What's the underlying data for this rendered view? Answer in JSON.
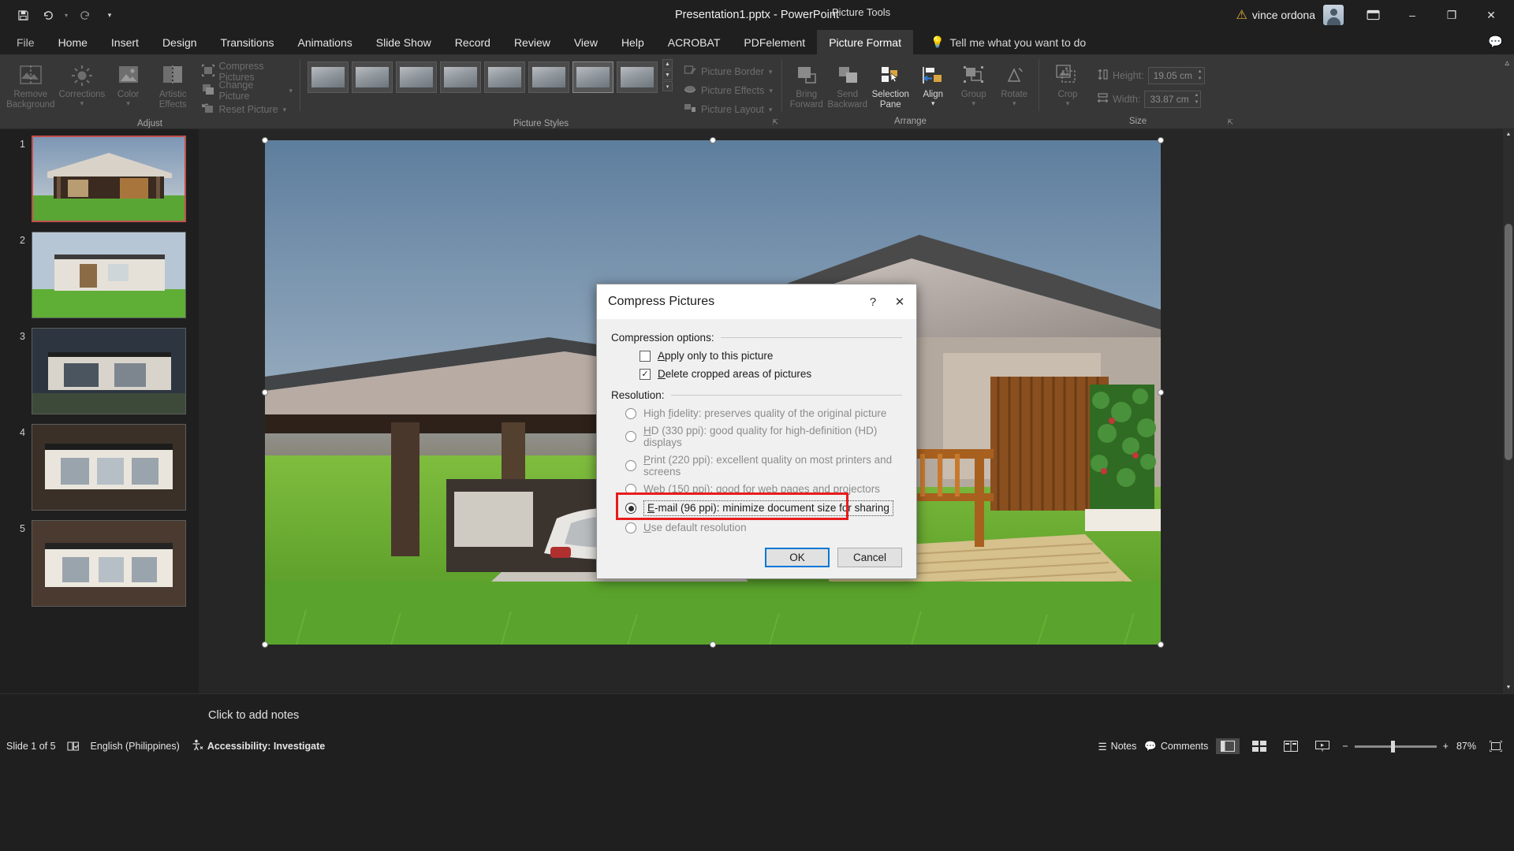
{
  "titlebar": {
    "save_icon": "save-icon",
    "undo_icon": "undo-icon",
    "redo_icon": "redo-icon",
    "customize_icon": "customize-qat-icon",
    "doc_title": "Presentation1.pptx  -  PowerPoint",
    "context_label": "Picture Tools",
    "warning_icon": "warning-icon",
    "user_name": "vince ordona",
    "avatar": "user-avatar",
    "ribbon_display_icon": "ribbon-display-options-icon",
    "minimize": "–",
    "restore": "❐",
    "close": "✕"
  },
  "tabs": [
    {
      "label": "File",
      "active": false
    },
    {
      "label": "Home",
      "active": false
    },
    {
      "label": "Insert",
      "active": false
    },
    {
      "label": "Design",
      "active": false
    },
    {
      "label": "Transitions",
      "active": false
    },
    {
      "label": "Animations",
      "active": false
    },
    {
      "label": "Slide Show",
      "active": false
    },
    {
      "label": "Record",
      "active": false
    },
    {
      "label": "Review",
      "active": false
    },
    {
      "label": "View",
      "active": false
    },
    {
      "label": "Help",
      "active": false
    },
    {
      "label": "ACROBAT",
      "active": false
    },
    {
      "label": "PDFelement",
      "active": false
    },
    {
      "label": "Picture Format",
      "active": true
    }
  ],
  "tellme": {
    "placeholder": "Tell me what you want to do",
    "bulb_icon": "lightbulb-icon",
    "comments_icon": "comments-icon"
  },
  "ribbon": {
    "groups": [
      {
        "label": "Adjust"
      },
      {
        "label": "Picture Styles"
      },
      {
        "label": "Arrange"
      },
      {
        "label": "Size"
      }
    ],
    "adjust": {
      "remove_background": "Remove\nBackground",
      "remove_background_l1": "Remove",
      "remove_background_l2": "Background",
      "corrections": "Corrections",
      "color": "Color",
      "artistic_effects_l1": "Artistic",
      "artistic_effects_l2": "Effects",
      "compress_pictures": "Compress Pictures",
      "change_picture": "Change Picture",
      "reset_picture": "Reset Picture"
    },
    "picture_styles": {
      "picture_border": "Picture Border",
      "picture_effects": "Picture Effects",
      "picture_layout": "Picture Layout",
      "thumb_count": 8,
      "selected_thumb": 6
    },
    "arrange": {
      "bring_forward_l1": "Bring",
      "bring_forward_l2": "Forward",
      "send_backward_l1": "Send",
      "send_backward_l2": "Backward",
      "selection_pane_l1": "Selection",
      "selection_pane_l2": "Pane",
      "align": "Align",
      "group": "Group",
      "rotate": "Rotate"
    },
    "size": {
      "crop": "Crop",
      "height_label": "Height:",
      "height_value": "19.05 cm",
      "width_label": "Width:",
      "width_value": "33.87 cm"
    }
  },
  "slides": [
    {
      "num": "1",
      "selected": true
    },
    {
      "num": "2",
      "selected": false
    },
    {
      "num": "3",
      "selected": false
    },
    {
      "num": "4",
      "selected": false
    },
    {
      "num": "5",
      "selected": false
    }
  ],
  "dialog": {
    "title": "Compress Pictures",
    "help_icon": "help-icon",
    "close_icon": "close-icon",
    "compression_options_label": "Compression options:",
    "checkboxes": [
      {
        "label": "Apply only to this picture",
        "checked": false,
        "accel": "A"
      },
      {
        "label": "Delete cropped areas of pictures",
        "checked": true,
        "accel": "D"
      }
    ],
    "resolution_label": "Resolution:",
    "resolutions": [
      {
        "label": "High fidelity: preserves quality of the original picture",
        "selected": false,
        "disabled": true
      },
      {
        "label": "HD (330 ppi): good quality for high-definition (HD) displays",
        "selected": false,
        "disabled": true
      },
      {
        "label": "Print (220 ppi): excellent quality on most printers and screens",
        "selected": false,
        "disabled": true
      },
      {
        "label": "Web (150 ppi): good for web pages and projectors",
        "selected": false,
        "disabled": true
      },
      {
        "label": "E-mail (96 ppi): minimize document size for sharing",
        "selected": true,
        "disabled": false,
        "highlighted": true
      },
      {
        "label": "Use default resolution",
        "selected": false,
        "disabled": true
      }
    ],
    "ok_label": "OK",
    "cancel_label": "Cancel",
    "highlight_color": "#e81c1c",
    "focus_color": "#0078d7"
  },
  "notes": {
    "placeholder": "Click to add notes"
  },
  "statusbar": {
    "slide_counter": "Slide 1 of 5",
    "spellcheck_icon": "spellcheck-icon",
    "language": "English (Philippines)",
    "accessibility_icon": "accessibility-icon",
    "accessibility": "Accessibility: Investigate",
    "notes_label": "Notes",
    "notes_icon": "notes-icon",
    "comments_label": "Comments",
    "comments_icon": "comments-icon",
    "view_normal_icon": "normal-view-icon",
    "view_sorter_icon": "slide-sorter-icon",
    "view_reading_icon": "reading-view-icon",
    "view_slideshow_icon": "slideshow-icon",
    "zoom_out_icon": "−",
    "zoom_in_icon": "+",
    "zoom_level": "87%",
    "fit_icon": "fit-slide-icon"
  }
}
